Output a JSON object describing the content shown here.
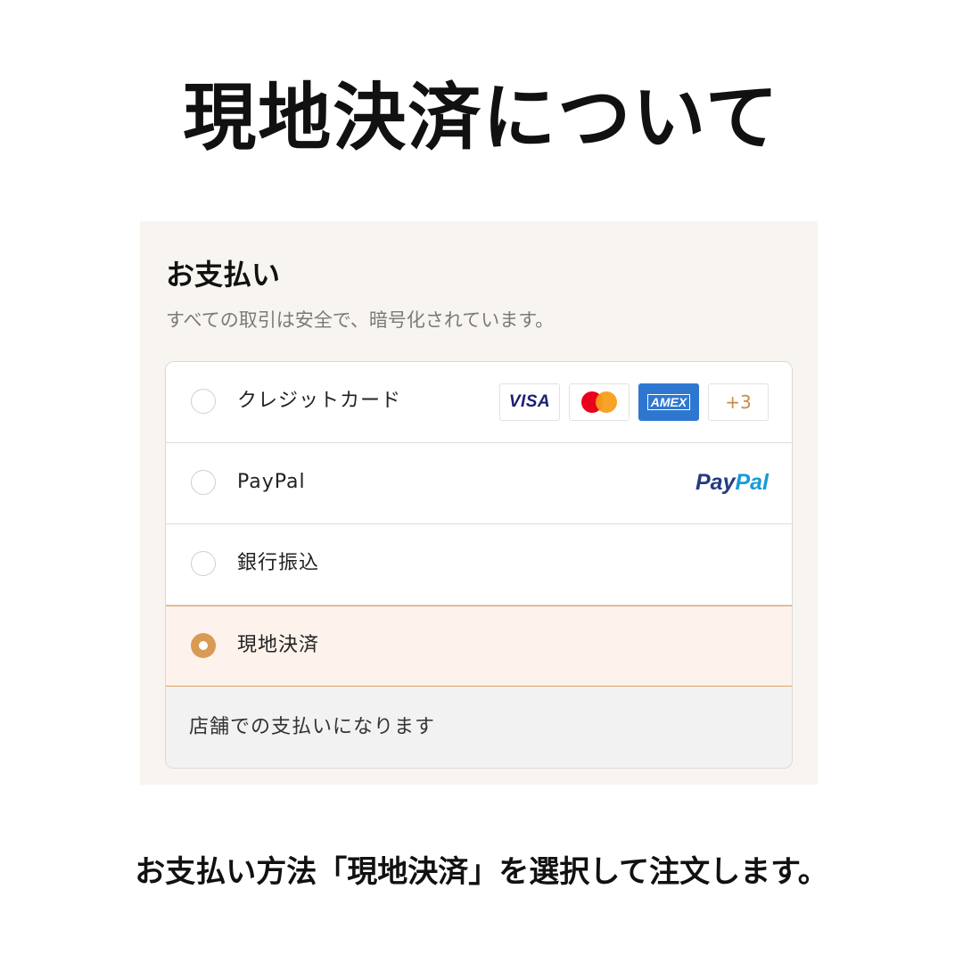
{
  "page": {
    "heading": "現地決済について",
    "caption": "お支払い方法「現地決済」を選択して注文します。"
  },
  "payment": {
    "title": "お支払い",
    "subtitle": "すべての取引は安全で、暗号化されています。",
    "options": [
      {
        "label": "クレジットカード",
        "selected": false,
        "logos": [
          {
            "name": "visa-logo",
            "text": "VISA"
          },
          {
            "name": "mastercard-logo",
            "text": ""
          },
          {
            "name": "amex-logo",
            "text": "AMEX"
          },
          {
            "name": "more-cards-badge",
            "text": "+3"
          }
        ]
      },
      {
        "label": "PayPal",
        "selected": false,
        "logo": {
          "pay": "Pay",
          "pal": "Pal"
        }
      },
      {
        "label": "銀行振込",
        "selected": false
      },
      {
        "label": "現地決済",
        "selected": true,
        "info": "店舗での支払いになります"
      }
    ]
  },
  "colors": {
    "accent": "#d99a55",
    "selected_background": "#fdf2ec",
    "panel_background": "#f8f5f0",
    "info_background": "#f2f2f2",
    "visa": "#1a1f71",
    "mastercard_red": "#eb001b",
    "mastercard_orange": "#f79e1b",
    "amex": "#2e77d0",
    "paypal_dark": "#253b80",
    "paypal_light": "#179bd7"
  }
}
